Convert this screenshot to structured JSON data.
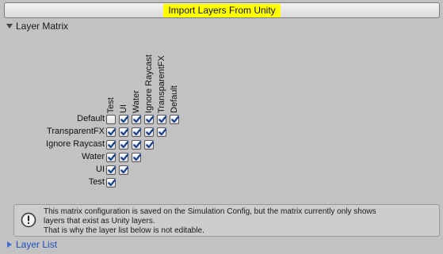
{
  "import_button": {
    "label": "Import Layers From Unity",
    "highlight_color": "#ffff00"
  },
  "layer_matrix": {
    "title": "Layer Matrix",
    "expanded": true,
    "columns": [
      "Test",
      "UI",
      "Water",
      "Ignore Raycast",
      "TransparentFX",
      "Default"
    ],
    "rows": [
      "Default",
      "TransparentFX",
      "Ignore Raycast",
      "Water",
      "UI",
      "Test"
    ],
    "cells": [
      [
        false,
        true,
        true,
        true,
        true,
        true
      ],
      [
        true,
        true,
        true,
        true,
        true
      ],
      [
        true,
        true,
        true,
        true
      ],
      [
        true,
        true,
        true
      ],
      [
        true,
        true
      ],
      [
        true
      ]
    ]
  },
  "help_box": {
    "icon": "info-icon",
    "lines": [
      "This matrix configuration is saved on the Simulation Config, but the matrix currently only shows",
      "layers that exist as Unity layers.",
      "That is why the layer list below is not editable."
    ]
  },
  "layer_list": {
    "title": "Layer List",
    "expanded": false,
    "color": "#1f4fbf"
  }
}
